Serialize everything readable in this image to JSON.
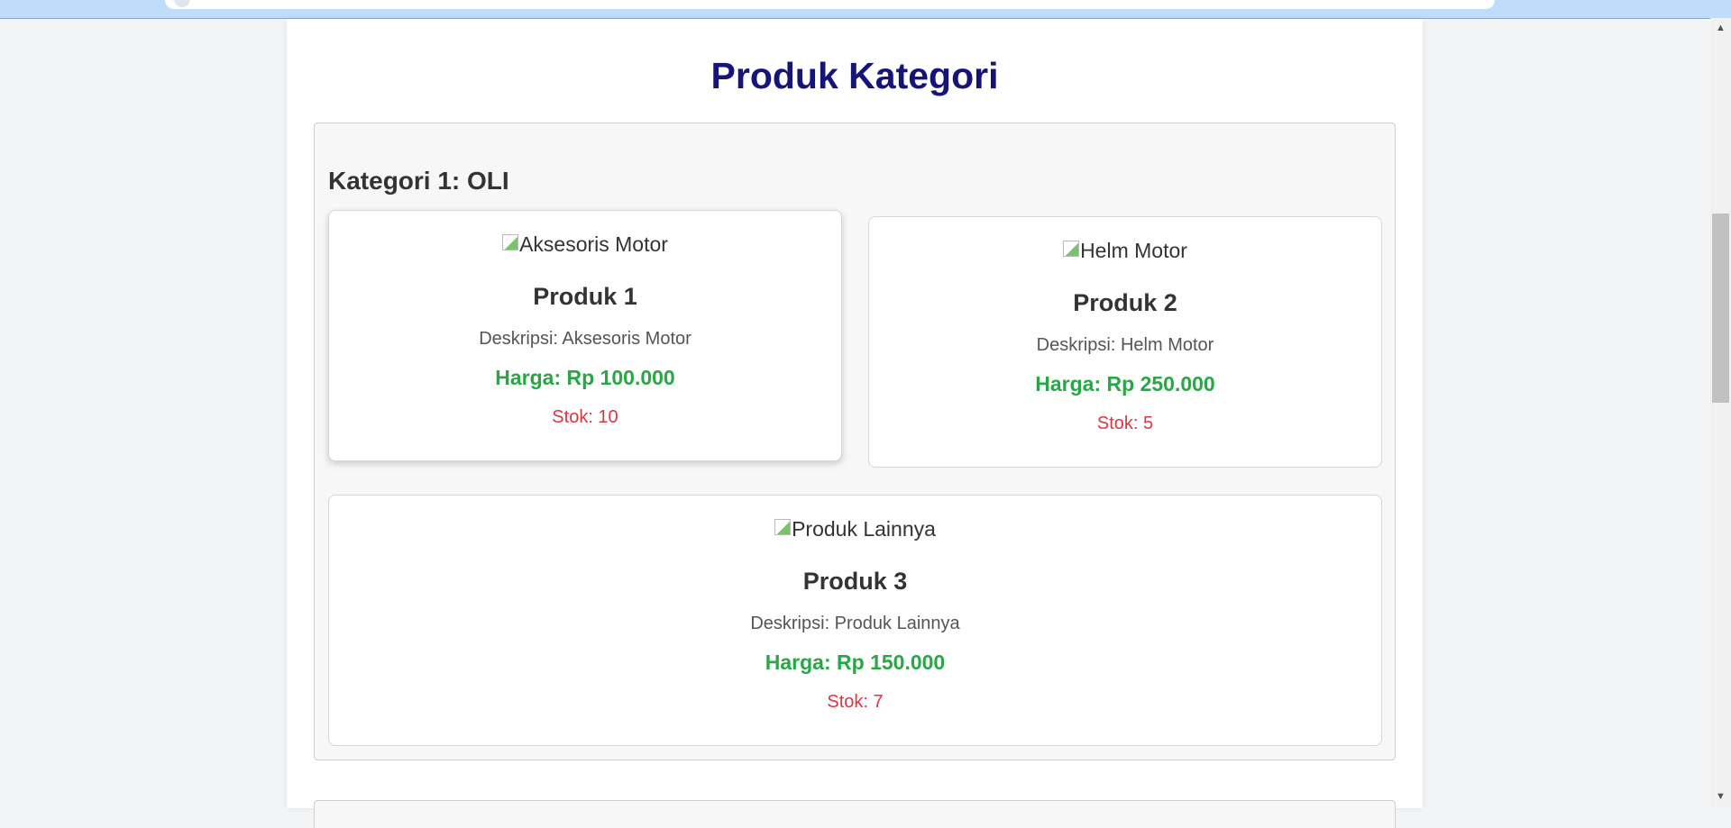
{
  "page": {
    "title": "Produk Kategori"
  },
  "category": {
    "heading": "Kategori 1: OLI",
    "products": [
      {
        "image_alt": "Aksesoris Motor",
        "name": "Produk 1",
        "description": "Deskripsi: Aksesoris Motor",
        "price": "Harga: Rp 100.000",
        "stock": "Stok: 10"
      },
      {
        "image_alt": "Helm Motor",
        "name": "Produk 2",
        "description": "Deskripsi: Helm Motor",
        "price": "Harga: Rp 250.000",
        "stock": "Stok: 5"
      },
      {
        "image_alt": "Produk Lainnya",
        "name": "Produk 3",
        "description": "Deskripsi: Produk Lainnya",
        "price": "Harga: Rp 150.000",
        "stock": "Stok: 7"
      }
    ]
  },
  "colors": {
    "title": "#151579",
    "price": "#28a745",
    "stock": "#dc3545",
    "background": "#f2f4f6"
  },
  "icons": {
    "broken_image": "broken-image-icon",
    "scroll_up": "scroll-up-arrow-icon",
    "scroll_down": "scroll-down-arrow-icon"
  }
}
